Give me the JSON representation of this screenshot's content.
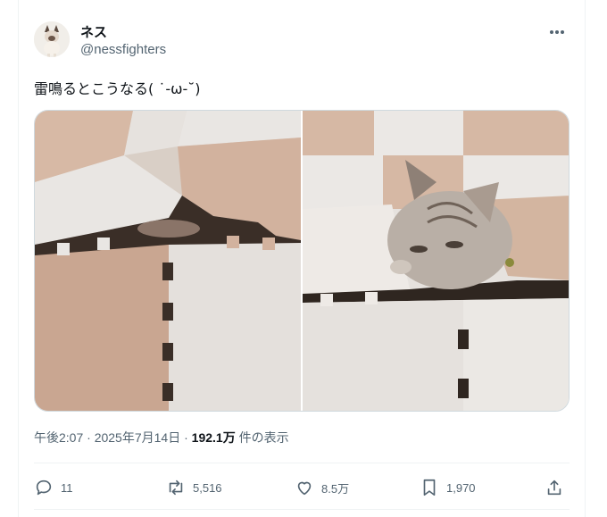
{
  "author": {
    "display_name": "ネス",
    "handle": "@nessfighters",
    "avatar_icon": "cat-avatar-icon"
  },
  "tweet": {
    "text": "雷鳴るとこうなる( ˙-ω-˘)",
    "time": "午後2:07",
    "separator": "·",
    "date": "2025年7月14日",
    "views_count": "192.1万",
    "views_label": "件の表示"
  },
  "media": [
    {
      "description_icon": "cat-under-foam-mat-photo"
    },
    {
      "description_icon": "cat-peeking-from-foam-mat-photo"
    }
  ],
  "actions": {
    "reply": {
      "icon": "reply-icon",
      "count": "11"
    },
    "retweet": {
      "icon": "retweet-icon",
      "count": "5,516"
    },
    "like": {
      "icon": "heart-icon",
      "count": "8.5万"
    },
    "bookmark": {
      "icon": "bookmark-icon",
      "count": "1,970"
    },
    "share": {
      "icon": "share-icon"
    }
  },
  "colors": {
    "text": "#0f1419",
    "muted": "#536471",
    "border": "#eff3f4"
  }
}
